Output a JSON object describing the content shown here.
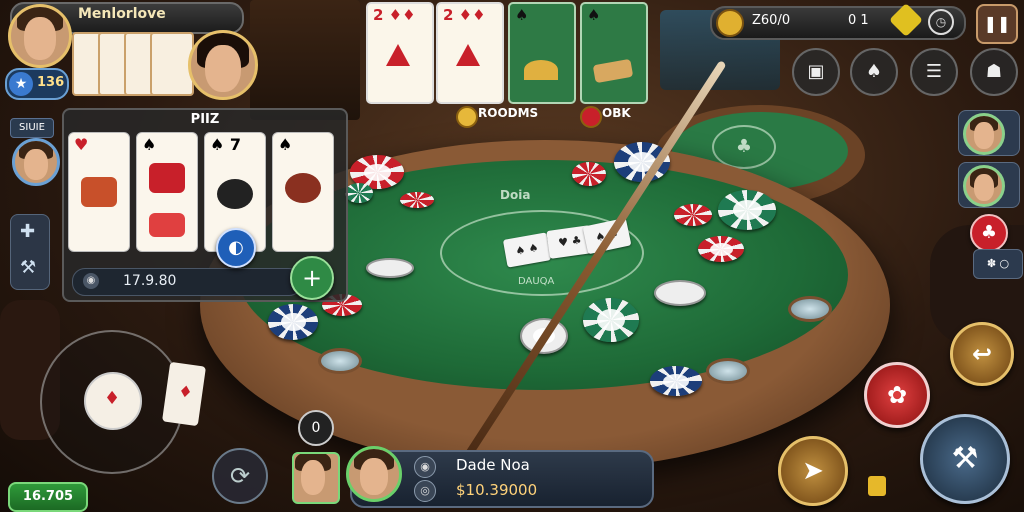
{
  "player": {
    "name": "Menlorlove",
    "level": "136"
  },
  "hand_panel": {
    "title": "PIIZ",
    "amount": "17.9.80",
    "cards": [
      "♥",
      "♠",
      "♠ 7",
      "♠"
    ]
  },
  "top_cards": [
    "2 ♦♦",
    "2 ♦♦",
    "♠",
    "♠"
  ],
  "top_labels": {
    "rooms": "ROODMS",
    "ok": "OBK"
  },
  "top_bar": {
    "coins": "Z60/0",
    "counter": "0 1"
  },
  "side_badge": "SIUIE",
  "table": {
    "felt_title": "Doia",
    "felt_sub": "DAUQA"
  },
  "felt_cards": [
    "♠ ♠",
    "♥ ♣",
    "♠ ♠"
  ],
  "bottom_player": {
    "name": "Dade Noa",
    "chips": "$10.39000"
  },
  "balance": "16.705",
  "timer": "0",
  "wl_badge": "✽ ○",
  "icons": {
    "pause": "pause-icon",
    "settings": "gear-icon",
    "refresh": "refresh-icon",
    "send": "send-icon",
    "add": "plus-icon",
    "lock": "lock-icon"
  },
  "colors": {
    "felt": "#1e6a37",
    "gold": "#e6c06a",
    "red_action": "#c8202a"
  }
}
